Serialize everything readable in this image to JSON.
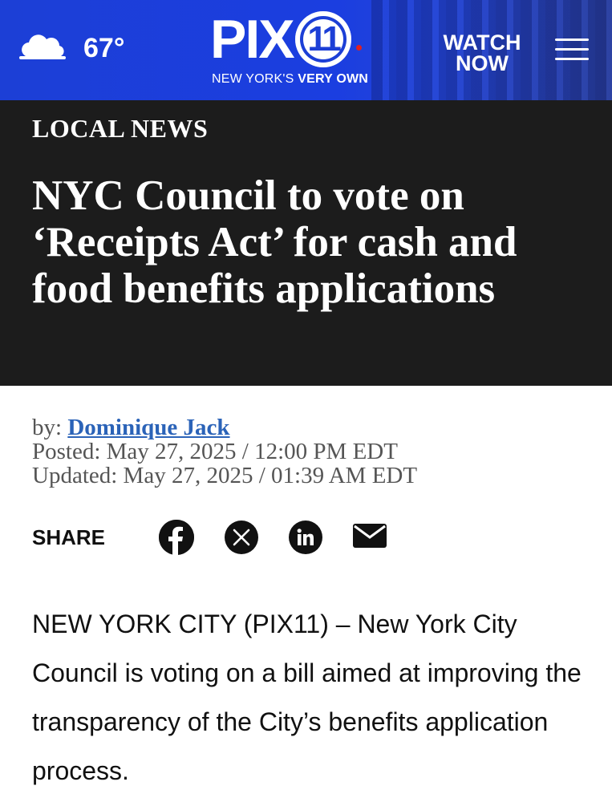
{
  "header": {
    "weather_icon": "cloud-icon",
    "temperature": "67°",
    "logo_text": "PIX",
    "logo_number": "11",
    "tagline_regular": "NEW YORK'S ",
    "tagline_bold": "VERY OWN",
    "watch_line1": "WATCH",
    "watch_line2": "NOW",
    "menu_icon": "hamburger-menu-icon",
    "accent_color": "#1c3fd6"
  },
  "banner": {
    "category": "LOCAL NEWS",
    "headline": "NYC Council to vote on ‘Receipts Act’ for cash and food benefits applications"
  },
  "meta": {
    "by_label": "by: ",
    "author": "Dominique Jack",
    "posted": "Posted: May 27, 2025 / 12:00 PM EDT",
    "updated": "Updated: May 27, 2025 / 01:39 AM EDT"
  },
  "share": {
    "label": "SHARE",
    "icons": [
      "facebook-icon",
      "x-icon",
      "linkedin-icon",
      "email-icon"
    ]
  },
  "article": {
    "body": "NEW YORK CITY (PIX11) – New York City Council is voting on a bill aimed at improving the transparency of the City’s benefits application process."
  }
}
